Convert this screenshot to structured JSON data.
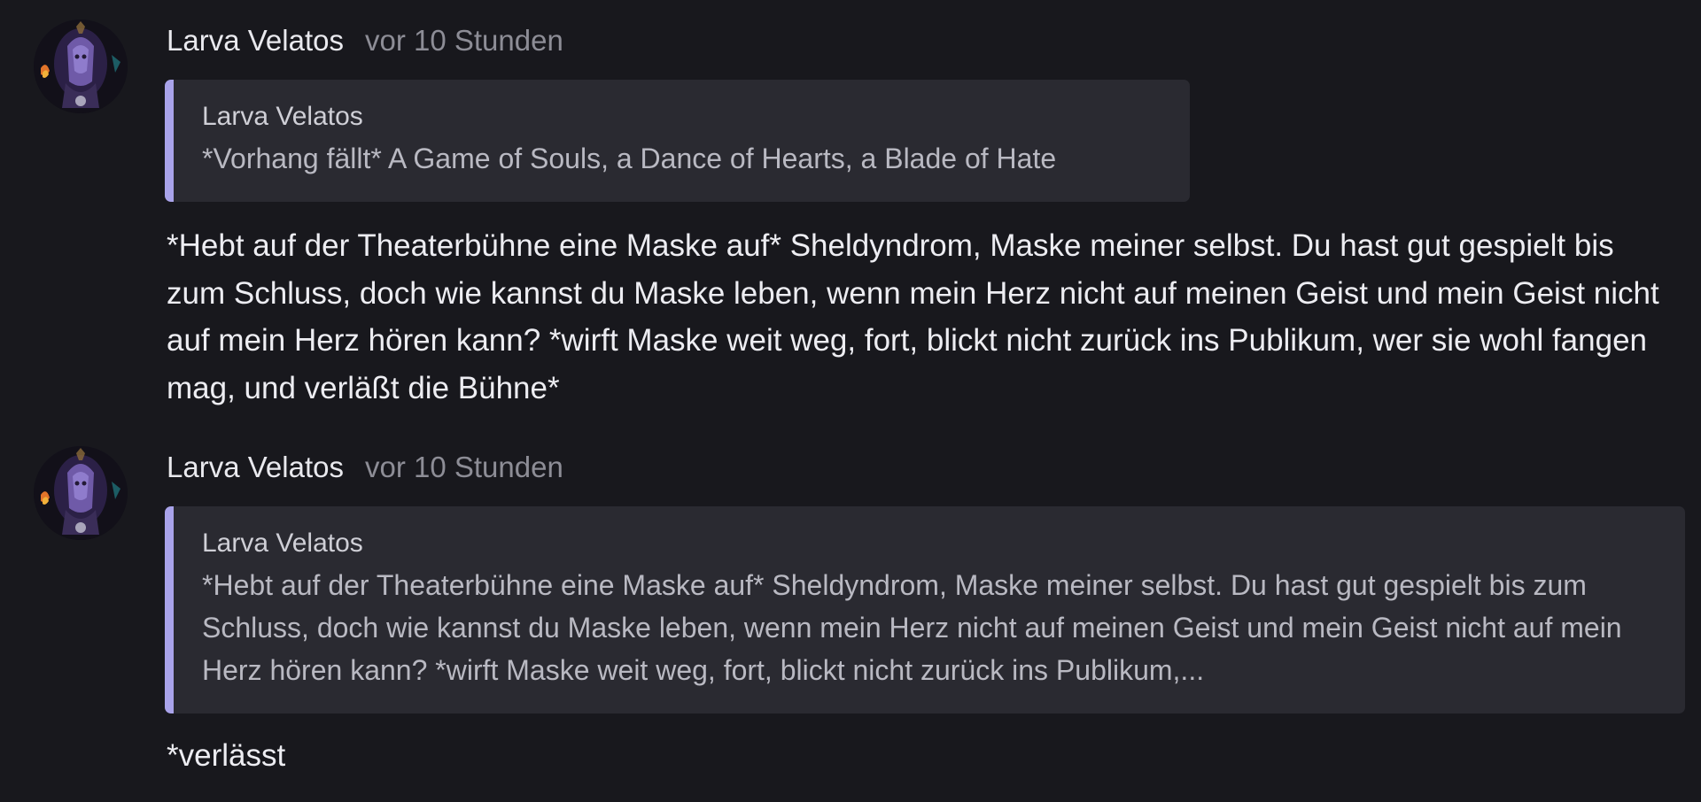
{
  "messages": [
    {
      "author": "Larva Velatos",
      "time": "vor 10 Stunden",
      "quote": {
        "author": "Larva Velatos",
        "text": "*Vorhang fällt* A Game of Souls, a Dance of Hearts, a Blade of Hate"
      },
      "body": "*Hebt auf der Theaterbühne eine Maske auf* Sheldyndrom, Maske meiner selbst. Du hast gut gespielt bis zum Schluss, doch wie kannst du Maske leben, wenn mein Herz nicht auf meinen Geist und mein Geist nicht auf mein Herz hören kann? *wirft Maske weit weg, fort, blickt nicht zurück ins Publikum, wer sie wohl fangen mag, und verläßt die Bühne*"
    },
    {
      "author": "Larva Velatos",
      "time": "vor 10 Stunden",
      "quote": {
        "author": "Larva Velatos",
        "text": "*Hebt auf der Theaterbühne eine Maske auf* Sheldyndrom, Maske meiner selbst. Du hast gut gespielt bis zum Schluss, doch wie kannst du Maske leben, wenn mein Herz nicht auf meinen Geist und mein Geist nicht auf mein Herz hören kann? *wirft Maske weit weg, fort, blickt nicht zurück ins Publikum,..."
      },
      "body": "*verlässt"
    }
  ],
  "colors": {
    "background": "#18181d",
    "quote_background": "#2a2a31",
    "quote_accent": "#a9a3ea",
    "author_text": "#e9e9ee",
    "timestamp_text": "#8d8d96",
    "body_text": "#ededf2"
  },
  "icons": {
    "avatar": "user-avatar-image"
  }
}
